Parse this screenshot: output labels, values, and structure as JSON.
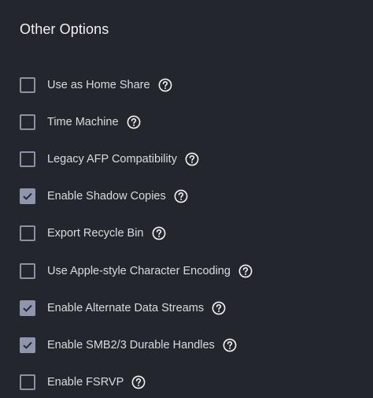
{
  "section": {
    "title": "Other Options"
  },
  "options": [
    {
      "label": "Use as Home Share",
      "checked": false
    },
    {
      "label": "Time Machine",
      "checked": false
    },
    {
      "label": "Legacy AFP Compatibility",
      "checked": false
    },
    {
      "label": "Enable Shadow Copies",
      "checked": true
    },
    {
      "label": "Export Recycle Bin",
      "checked": false
    },
    {
      "label": "Use Apple-style Character Encoding",
      "checked": false
    },
    {
      "label": "Enable Alternate Data Streams",
      "checked": true
    },
    {
      "label": "Enable SMB2/3 Durable Handles",
      "checked": true
    },
    {
      "label": "Enable FSRVP",
      "checked": false
    }
  ],
  "icons": {
    "help": "help-circle-icon",
    "check": "checkmark-icon"
  },
  "colors": {
    "background": "#24262e",
    "checkbox_border": "#8c91a6",
    "checkbox_checked": "#8f95ad",
    "text": "#d9dbe1"
  }
}
